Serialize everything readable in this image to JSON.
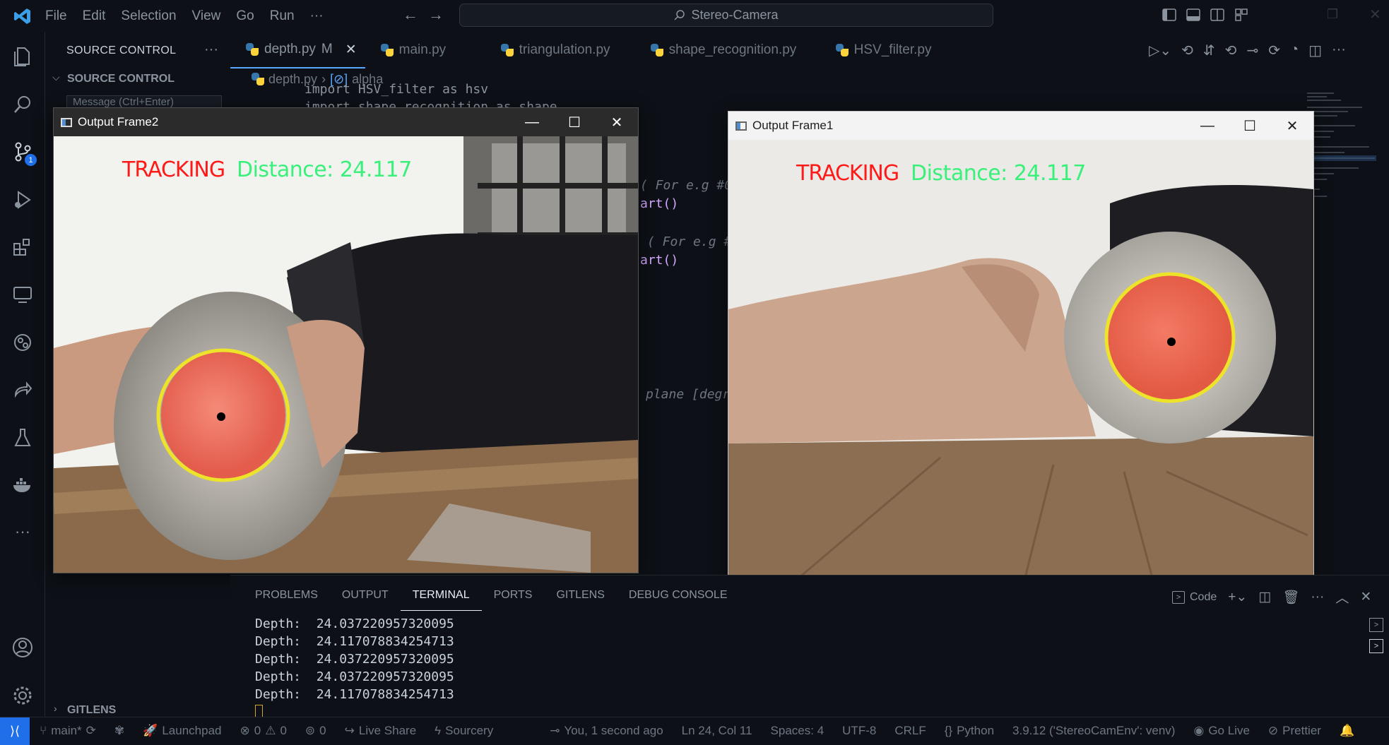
{
  "menu": [
    "File",
    "Edit",
    "Selection",
    "View",
    "Go",
    "Run",
    "···"
  ],
  "command_center": "Stereo-Camera",
  "sidebar": {
    "title": "SOURCE CONTROL",
    "section": "SOURCE CONTROL",
    "message_placeholder": "Message (Ctrl+Enter)",
    "gitlens": "GITLENS",
    "badge": "1"
  },
  "tabs": [
    {
      "label": "depth.py",
      "suffix": "M"
    },
    {
      "label": "main.py"
    },
    {
      "label": "triangulation.py"
    },
    {
      "label": "shape_recognition.py"
    },
    {
      "label": "HSV_filter.py"
    }
  ],
  "breadcrumb": {
    "file": "depth.py",
    "symbol": "alpha"
  },
  "code": {
    "line1": "import HSV_filter as hsv",
    "line2": "import shape_recognition as shape",
    "frag1": "( For e.g #0",
    "frag2": "art()",
    "frag3": "( For e.g #",
    "frag4": "art()",
    "frag5": "plane [degr"
  },
  "window2": {
    "title": "Output Frame2",
    "tracking": "TRACKING",
    "distance": "Distance: 24.117"
  },
  "window1": {
    "title": "Output Frame1",
    "tracking": "TRACKING",
    "distance": "Distance: 24.117"
  },
  "panel": {
    "tabs": [
      "PROBLEMS",
      "OUTPUT",
      "TERMINAL",
      "PORTS",
      "GITLENS",
      "DEBUG CONSOLE"
    ],
    "active": "TERMINAL",
    "shell": "Code",
    "lines": [
      "Depth:  24.037220957320095",
      "Depth:  24.117078834254713",
      "Depth:  24.037220957320095",
      "Depth:  24.037220957320095",
      "Depth:  24.117078834254713"
    ]
  },
  "status": {
    "branch": "main*",
    "launchpad": "Launchpad",
    "errors": "0",
    "warnings": "0",
    "ports": "0",
    "liveshare": "Live Share",
    "sourcery": "Sourcery",
    "blame": "You, 1 second ago",
    "position": "Ln 24, Col 11",
    "spaces": "Spaces: 4",
    "encoding": "UTF-8",
    "eol": "CRLF",
    "language": "Python",
    "interpreter": "3.9.12 ('StereoCamEnv': venv)",
    "golive": "Go Live",
    "prettier": "Prettier"
  },
  "colors": {
    "accent": "#58a6ff",
    "tracking": "#ff1a1a",
    "distance": "#38f07a",
    "ring": "#f2e600",
    "ball": "#f07060"
  }
}
